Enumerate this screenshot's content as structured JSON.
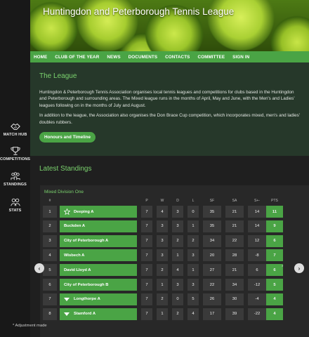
{
  "site": {
    "title": "Huntingdon and Peterborough Tennis League"
  },
  "nav": [
    "HOME",
    "CLUB OF THE YEAR",
    "NEWS",
    "DOCUMENTS",
    "CONTACTS",
    "COMMITTEE",
    "SIGN IN"
  ],
  "rail": [
    {
      "label": "MATCH HUB",
      "icon": "handshake-icon"
    },
    {
      "label": "COMPETITIONS",
      "icon": "trophy-icon"
    },
    {
      "label": "STANDINGS",
      "icon": "standings-icon"
    },
    {
      "label": "STATS",
      "icon": "stats-icon"
    }
  ],
  "league": {
    "heading": "The League",
    "para1": "Huntingdon & Peterborough Tennis Association organises local tennis leagues and competitions for clubs based in the Huntingdon and Peterborough and surrounding areas. The Mixed league runs in the months of April, May and June, with the Men's and Ladies' leagues following on in the months of July and August.",
    "para2": "In addition to the league, the Association also organises the Don Brace Cup competition, which incorporates mixed, men's and ladies' doubles rubbers.",
    "button": "Honours and Timeline"
  },
  "standings": {
    "heading": "Latest Standings",
    "division": "Mixed Division One",
    "columns": [
      "#",
      "P",
      "W",
      "D",
      "L",
      "SF",
      "SA",
      "S+-",
      "PTS"
    ],
    "rows": [
      {
        "pos": "1",
        "team": "Deeping A",
        "marker": "star",
        "p": "7",
        "w": "4",
        "d": "3",
        "l": "0",
        "sf": "35",
        "sa": "21",
        "diff": "14",
        "pts": "11"
      },
      {
        "pos": "2",
        "team": "Buckden A",
        "marker": "",
        "p": "7",
        "w": "3",
        "d": "3",
        "l": "1",
        "sf": "35",
        "sa": "21",
        "diff": "14",
        "pts": "9"
      },
      {
        "pos": "3",
        "team": "City of Peterborough A",
        "marker": "",
        "p": "7",
        "w": "3",
        "d": "2",
        "l": "2",
        "sf": "34",
        "sa": "22",
        "diff": "12",
        "pts": "6"
      },
      {
        "pos": "4",
        "team": "Wisbech A",
        "marker": "",
        "p": "7",
        "w": "3",
        "d": "1",
        "l": "3",
        "sf": "20",
        "sa": "28",
        "diff": "-8",
        "pts": "7"
      },
      {
        "pos": "5",
        "team": "David Lloyd A",
        "marker": "",
        "p": "7",
        "w": "2",
        "d": "4",
        "l": "1",
        "sf": "27",
        "sa": "21",
        "diff": "6",
        "pts": "6"
      },
      {
        "pos": "6",
        "team": "City of Peterborough B",
        "marker": "",
        "p": "7",
        "w": "1",
        "d": "3",
        "l": "3",
        "sf": "22",
        "sa": "34",
        "diff": "-12",
        "pts": "5"
      },
      {
        "pos": "7",
        "team": "Longthorpe A",
        "marker": "down",
        "p": "7",
        "w": "2",
        "d": "0",
        "l": "5",
        "sf": "26",
        "sa": "30",
        "diff": "-4",
        "pts": "4"
      },
      {
        "pos": "8",
        "team": "Stamford A",
        "marker": "down",
        "p": "7",
        "w": "1",
        "d": "2",
        "l": "4",
        "sf": "17",
        "sa": "39",
        "diff": "-22",
        "pts": "4"
      }
    ],
    "footnote": "* Adjustment made",
    "prev": "‹",
    "next": "›",
    "edge_mark": "*"
  }
}
